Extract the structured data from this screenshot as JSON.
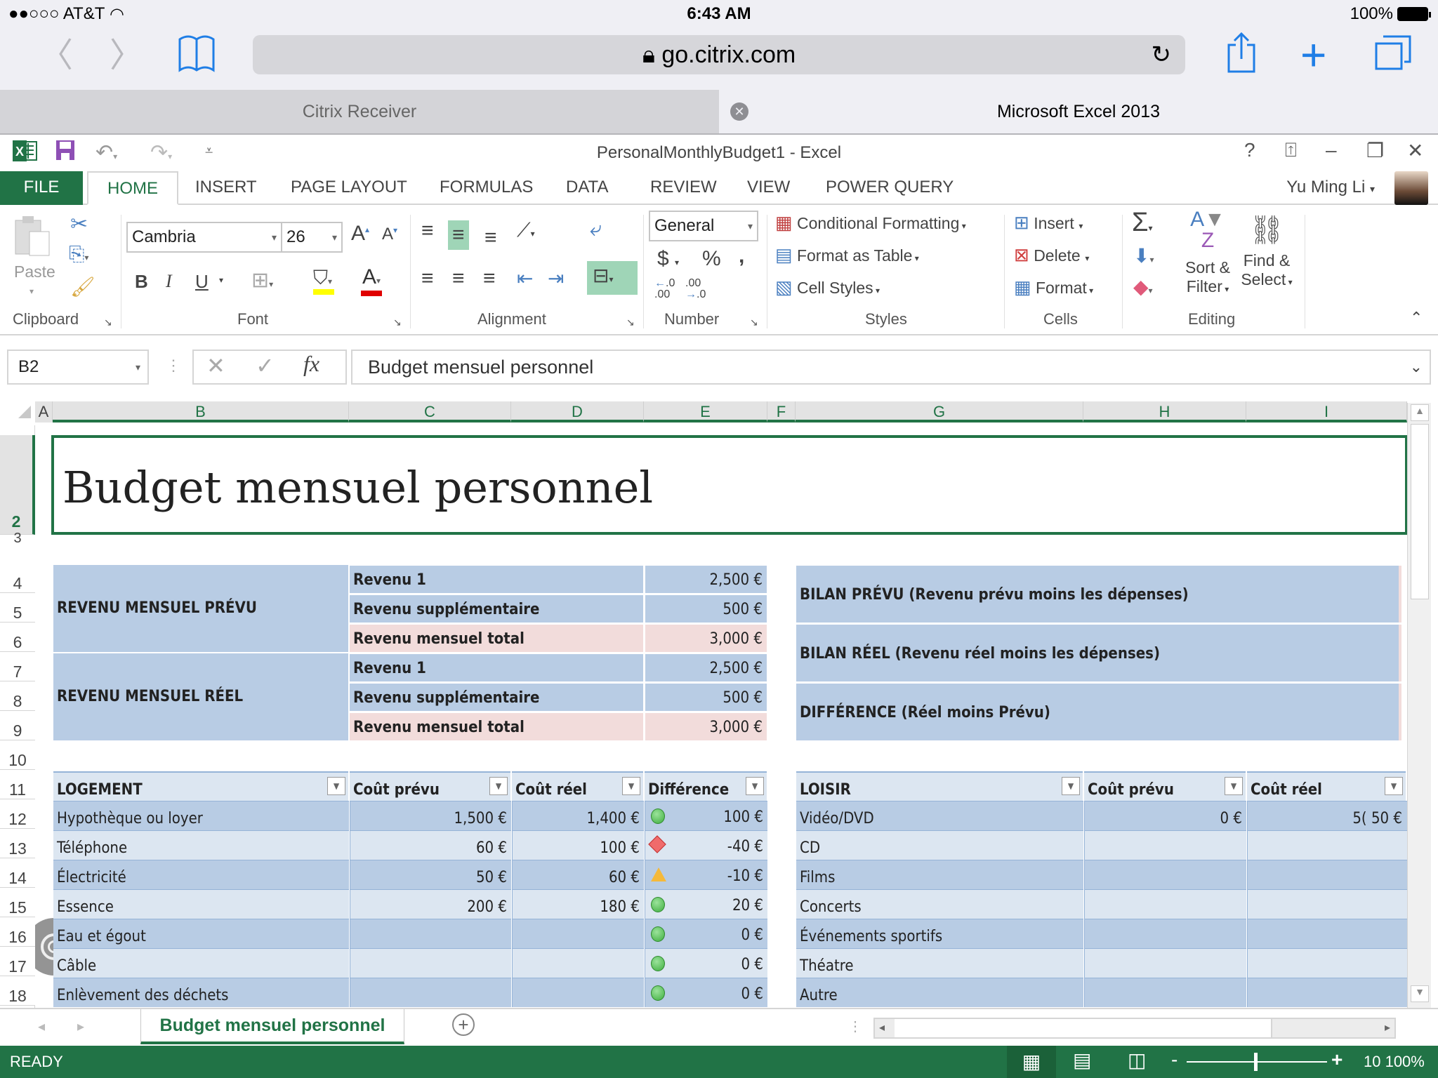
{
  "ios_status": {
    "carrier": "●●○○○ AT&T",
    "time": "6:43 AM",
    "battery": "100%"
  },
  "safari": {
    "url": "go.citrix.com",
    "tabs": [
      {
        "label": "Citrix Receiver",
        "active": false
      },
      {
        "label": "Microsoft Excel 2013",
        "active": true
      }
    ]
  },
  "excel": {
    "window_title": "PersonalMonthlyBudget1 - Excel",
    "ribbon_tabs": [
      "FILE",
      "HOME",
      "INSERT",
      "PAGE LAYOUT",
      "FORMULAS",
      "DATA",
      "REVIEW",
      "VIEW",
      "POWER QUERY"
    ],
    "active_tab": "HOME",
    "user": "Yu Ming Li",
    "ribbon": {
      "clipboard": {
        "label": "Clipboard",
        "paste": "Paste"
      },
      "font": {
        "label": "Font",
        "family": "Cambria",
        "size": "26",
        "bold": "B",
        "italic": "I",
        "underline": "U"
      },
      "alignment": {
        "label": "Alignment"
      },
      "number": {
        "label": "Number",
        "format": "General",
        "currency": "$",
        "percent": "%",
        "comma": ","
      },
      "styles": {
        "label": "Styles",
        "conditional_formatting": "Conditional Formatting",
        "format_as_table": "Format as Table",
        "cell_styles": "Cell Styles"
      },
      "cells": {
        "label": "Cells",
        "insert": "Insert",
        "delete": "Delete",
        "format": "Format"
      },
      "editing": {
        "label": "Editing",
        "sort_filter_1": "Sort &",
        "sort_filter_2": "Filter",
        "find_select_1": "Find &",
        "find_select_2": "Select"
      }
    },
    "name_box": "B2",
    "formula": "Budget mensuel personnel",
    "columns": [
      "A",
      "B",
      "C",
      "D",
      "E",
      "F",
      "G",
      "H",
      "I"
    ],
    "rows": [
      "2",
      "3",
      "4",
      "5",
      "6",
      "7",
      "8",
      "9",
      "10",
      "11",
      "12",
      "13",
      "14",
      "15",
      "16",
      "17",
      "18"
    ],
    "sheet_title": "Budget mensuel personnel",
    "income": {
      "planned_label": "REVENU MENSUEL PRÉVU",
      "actual_label": "REVENU MENSUEL RÉEL",
      "planned": [
        {
          "label": "Revenu 1",
          "value": "2,500 €"
        },
        {
          "label": "Revenu supplémentaire",
          "value": "500 €"
        },
        {
          "label": "Revenu mensuel total",
          "value": "3,000 €"
        }
      ],
      "actual": [
        {
          "label": "Revenu 1",
          "value": "2,500 €"
        },
        {
          "label": "Revenu supplémentaire",
          "value": "500 €"
        },
        {
          "label": "Revenu mensuel total",
          "value": "3,000 €"
        }
      ]
    },
    "balance": [
      "BILAN PRÉVU (Revenu prévu moins les dépenses)",
      "BILAN RÉEL (Revenu réel moins les dépenses)",
      "DIFFÉRENCE (Réel moins Prévu)"
    ],
    "housing": {
      "headers": [
        "LOGEMENT",
        "Coût prévu",
        "Coût réel",
        "Différence"
      ],
      "rows": [
        {
          "item": "Hypothèque ou loyer",
          "planned": "1,500 €",
          "actual": "1,400 €",
          "indicator": "green",
          "diff": "100 €"
        },
        {
          "item": "Téléphone",
          "planned": "60 €",
          "actual": "100 €",
          "indicator": "red",
          "diff": "-40 €"
        },
        {
          "item": "Électricité",
          "planned": "50 €",
          "actual": "60 €",
          "indicator": "yellow",
          "diff": "-10 €"
        },
        {
          "item": "Essence",
          "planned": "200 €",
          "actual": "180 €",
          "indicator": "green",
          "diff": "20 €"
        },
        {
          "item": "Eau et égout",
          "planned": "",
          "actual": "",
          "indicator": "green",
          "diff": "0 €"
        },
        {
          "item": "Câble",
          "planned": "",
          "actual": "",
          "indicator": "green",
          "diff": "0 €"
        },
        {
          "item": "Enlèvement des déchets",
          "planned": "",
          "actual": "",
          "indicator": "green",
          "diff": "0 €"
        }
      ]
    },
    "leisure": {
      "headers": [
        "LOISIR",
        "Coût prévu",
        "Coût réel"
      ],
      "rows": [
        {
          "item": "Vidéo/DVD",
          "planned": "0 €",
          "actual": "5( 50 €"
        },
        {
          "item": "CD",
          "planned": "",
          "actual": ""
        },
        {
          "item": "Films",
          "planned": "",
          "actual": ""
        },
        {
          "item": "Concerts",
          "planned": "",
          "actual": ""
        },
        {
          "item": "Événements sportifs",
          "planned": "",
          "actual": ""
        },
        {
          "item": "Théatre",
          "planned": "",
          "actual": ""
        },
        {
          "item": "Autre",
          "planned": "",
          "actual": ""
        }
      ]
    },
    "sheet_tab": "Budget mensuel personnel",
    "status": "READY",
    "zoom": "10 100%"
  }
}
